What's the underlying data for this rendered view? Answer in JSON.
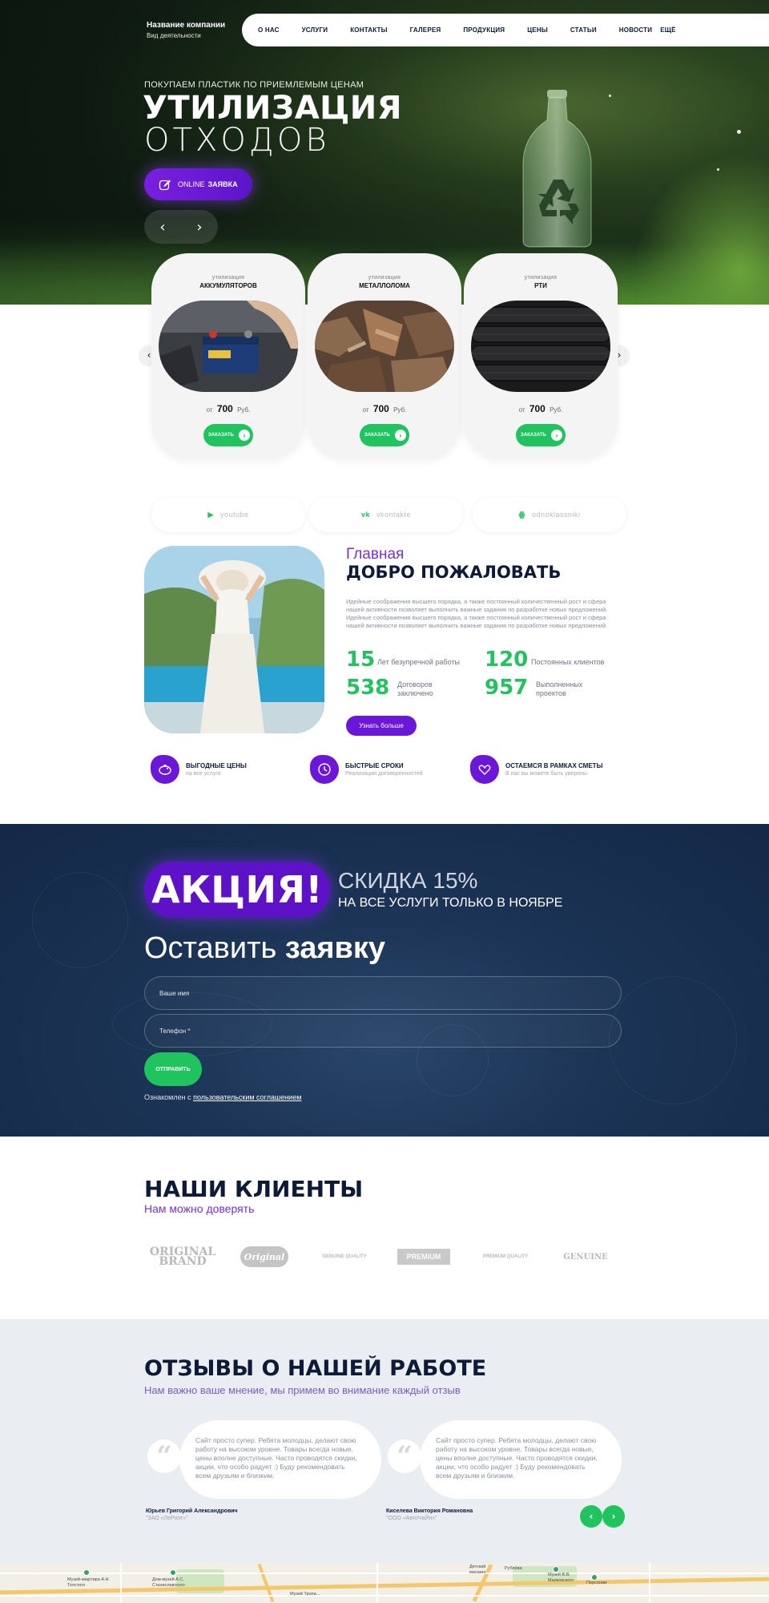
{
  "header": {
    "company_name": "Название компании",
    "company_activity": "Вид деятельности",
    "nav": [
      "О НАС",
      "УСЛУГИ",
      "КОНТАКТЫ",
      "ГАЛЕРЕЯ",
      "ПРОДУКЦИЯ",
      "ЦЕНЫ",
      "СТАТЬИ",
      "НОВОСТИ",
      "ЕЩЁ"
    ]
  },
  "hero": {
    "kicker": "ПОКУПАЕМ ПЛАСТИК ПО ПРИЕМЛЕМЫМ ЦЕНАМ",
    "title_bold": "УТИЛИЗАЦИЯ",
    "title_light": "ОТХОДОВ",
    "cta_prefix": "ONLINE",
    "cta_bold": "ЗАЯВКА",
    "prev_icon": "chevron-left-icon",
    "next_icon": "chevron-right-icon"
  },
  "products": {
    "items": [
      {
        "kicker": "утилизация",
        "title": "АККУМУЛЯТОРОВ",
        "price_prefix": "от",
        "price": "700",
        "currency": "Руб.",
        "button": "ЗАКАЗАТЬ",
        "image": "car-battery-photo"
      },
      {
        "kicker": "утилизация",
        "title": "МЕТАЛЛОЛОМА",
        "price_prefix": "от",
        "price": "700",
        "currency": "Руб.",
        "button": "ЗАКАЗАТЬ",
        "image": "scrap-metal-photo"
      },
      {
        "kicker": "утилизация",
        "title": "РТИ",
        "price_prefix": "от",
        "price": "700",
        "currency": "Руб.",
        "button": "ЗАКАЗАТЬ",
        "image": "tires-photo"
      }
    ]
  },
  "social": [
    {
      "label": "youtube",
      "icon": "youtube-icon",
      "color": "#1fc45f"
    },
    {
      "label": "vkontakte",
      "icon": "vk-icon",
      "color": "#1fc45f"
    },
    {
      "label": "odnoklassniki",
      "icon": "odnoklassniki-icon",
      "color": "#1fc45f"
    }
  ],
  "welcome": {
    "kicker": "Главная",
    "title": "ДОБРО ПОЖАЛОВАТЬ",
    "text": "Идейные соображения высшего порядка, а также постоянный количественный рост и сфера нашей активности позволяет выполнить важные задания по разработке новых предложений. Идейные соображения высшего порядка, а также постоянный количественный рост и сфера нашей активности позволяет выполнить важные задания по разработке новых предложений",
    "stats": [
      {
        "value": "15",
        "label": "Лет безупречной работы"
      },
      {
        "value": "120",
        "label": "Постоянных клиентов"
      },
      {
        "value": "538",
        "label": "Договоров заключено"
      },
      {
        "value": "957",
        "label": "Выполненных проектов"
      }
    ],
    "button": "Узнать больше"
  },
  "features": [
    {
      "title": "ВЫГОДНЫЕ ЦЕНЫ",
      "subtitle": "на все услуги",
      "icon": "piggy-bank-icon"
    },
    {
      "title": "БЫСТРЫЕ СРОКИ",
      "subtitle": "Реализации договоренностей",
      "icon": "recycle-clock-icon"
    },
    {
      "title": "ОСТАЕМСЯ В РАМКАХ СМЕТЫ",
      "subtitle": "В нас вы можете быть уверены",
      "icon": "heart-hands-icon"
    }
  ],
  "promo": {
    "badge": "АКЦИЯ!",
    "discount": "СКИДКА 15%",
    "discount_note": "НА ВСЕ УСЛУГИ ТОЛЬКО В НОЯБРЕ",
    "form_title_light": "Оставить",
    "form_title_bold": "заявку",
    "name_placeholder": "Ваше имя",
    "phone_placeholder": "Телефон *",
    "submit": "ОТПРАВИТЬ",
    "agree_prefix": "Ознакомлен с",
    "agree_link": "пользовательским соглашением"
  },
  "clients": {
    "title": "НАШИ КЛИЕНТЫ",
    "subtitle": "Нам можно доверять",
    "logos": [
      "ORIGINAL BRAND",
      "Original",
      "GENUINE QUALITY",
      "PREMIUM",
      "PREMIUM QUALITY",
      "GENUINE"
    ]
  },
  "reviews": {
    "title": "ОТЗЫВЫ О НАШЕЙ РАБОТЕ",
    "subtitle": "Нам важно ваше мнение, мы примем во внимание каждый отзыв",
    "items": [
      {
        "text": "Сайт просто супер. Ребята молодцы, делают свою работу на высоком уровне. Товары всегда новые, цены вполне доступные. Часто проводятся скидки, акции, что особо радует :) Буду рекомендовать всем друзьям и близким.",
        "author": "Юрьев Григорий Александрович",
        "company": "\"ЗАО «ЛеРоот»\""
      },
      {
        "text": "Сайт просто супер. Ребята молодцы, делают свою работу на высоком уровне. Товары всегда новые, цены вполне доступные. Часто проводятся скидки, акции, что особо радует :) Буду рекомендовать всем друзьям и близким.",
        "author": "Киселева Виктория Романовна",
        "company": "\"ООО «АвтоЧаЙн»\""
      }
    ],
    "quote_icon": "quote-icon"
  },
  "map": {
    "labels": [
      "Музей-квартира А.Н. Толстого",
      "Дом-музей А.С. Станиславского",
      "Музей Тропи...",
      "Детский магазин",
      "Рублёва",
      "Музей В.В. Маяковского",
      "Персонаж"
    ]
  },
  "colors": {
    "accent_purple": "#6b17d9",
    "accent_green": "#1fc45f",
    "navy": "#0d1b36",
    "promo_bg": "#1b3354",
    "reviews_bg": "#eaedf2"
  }
}
